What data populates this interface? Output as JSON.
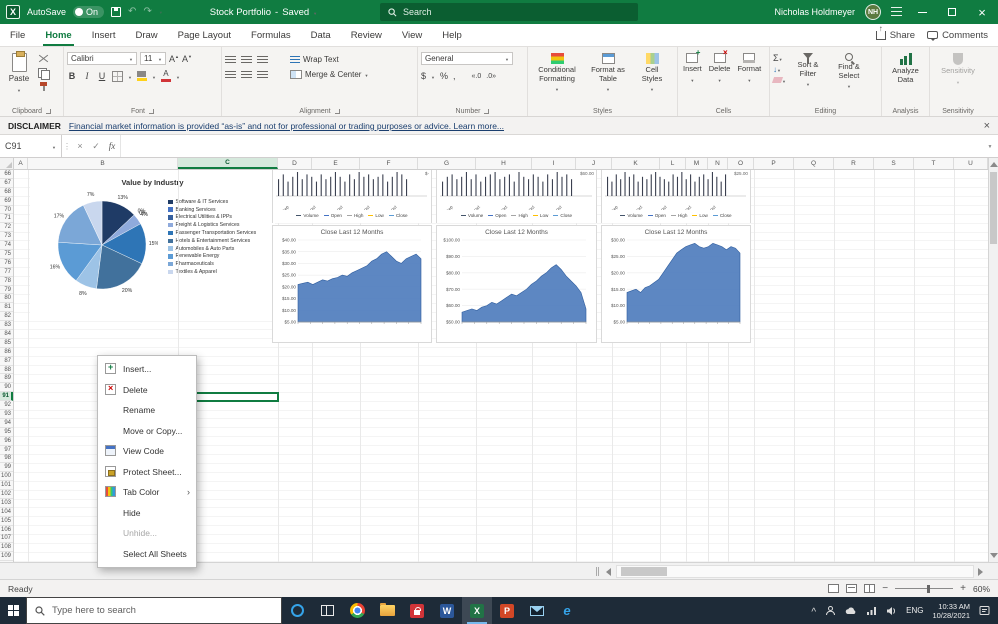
{
  "title_bar": {
    "app": "X",
    "autosave_label": "AutoSave",
    "autosave_state": "On",
    "doc_title": "Stock Portfolio",
    "separator": "-",
    "doc_status": "Saved",
    "search_placeholder": "Search",
    "user_name": "Nicholas Holdmeyer",
    "user_initials": "NH"
  },
  "ribbon": {
    "tabs": [
      {
        "label": "File",
        "active": false
      },
      {
        "label": "Home",
        "active": true
      },
      {
        "label": "Insert",
        "active": false
      },
      {
        "label": "Draw",
        "active": false
      },
      {
        "label": "Page Layout",
        "active": false
      },
      {
        "label": "Formulas",
        "active": false
      },
      {
        "label": "Data",
        "active": false
      },
      {
        "label": "Review",
        "active": false
      },
      {
        "label": "View",
        "active": false
      },
      {
        "label": "Help",
        "active": false
      }
    ],
    "share": "Share",
    "comments": "Comments",
    "clipboard": {
      "label": "Clipboard",
      "paste": "Paste"
    },
    "font": {
      "label": "Font",
      "name": "Calibri",
      "size": "11",
      "bold": "B",
      "italic": "I",
      "underline": "U"
    },
    "alignment": {
      "label": "Alignment",
      "wrap": "Wrap Text",
      "merge": "Merge & Center"
    },
    "number": {
      "label": "Number",
      "format": "General",
      "currency": "$",
      "percent": "%",
      "comma": ",",
      "inc_decimal": "«.0",
      "dec_decimal": ".0»"
    },
    "styles": {
      "label": "Styles",
      "conditional": "Conditional Formatting",
      "table": "Format as Table",
      "cell": "Cell Styles"
    },
    "cells": {
      "label": "Cells",
      "insert": "Insert",
      "delete": "Delete",
      "format": "Format"
    },
    "editing": {
      "label": "Editing",
      "sort": "Sort & Filter",
      "find": "Find & Select"
    },
    "analysis": {
      "label": "Analysis",
      "analyze": "Analyze Data"
    },
    "sensitivity": {
      "label": "Sensitivity",
      "button": "Sensitivity"
    }
  },
  "disclaimer": {
    "label": "DISCLAIMER",
    "text": "Financial market information is provided “as-is” and not for professional or trading purposes or advice. Learn more..."
  },
  "formula_bar": {
    "name_box": "C91",
    "fx": "fx",
    "formula": ""
  },
  "grid": {
    "columns": [
      "A",
      "B",
      "C",
      "D",
      "E",
      "F",
      "G",
      "H",
      "I",
      "J",
      "K",
      "L",
      "M",
      "N",
      "O",
      "P",
      "Q",
      "R",
      "S",
      "T",
      "U"
    ],
    "row_start": 66,
    "row_end": 109,
    "selected_column": "C",
    "selected_row": 91,
    "active_cell": "C91"
  },
  "context_menu": {
    "items": [
      {
        "label": "Insert...",
        "icon": "insert-sheet",
        "enabled": true,
        "submenu": false
      },
      {
        "label": "Delete",
        "icon": "delete-sheet",
        "enabled": true,
        "submenu": false
      },
      {
        "label": "Rename",
        "icon": "",
        "enabled": true,
        "submenu": false
      },
      {
        "label": "Move or Copy...",
        "icon": "",
        "enabled": true,
        "submenu": false
      },
      {
        "label": "View Code",
        "icon": "view-code",
        "enabled": true,
        "submenu": false
      },
      {
        "label": "Protect Sheet...",
        "icon": "protect-sheet",
        "enabled": true,
        "submenu": false
      },
      {
        "label": "Tab Color",
        "icon": "tab-color",
        "enabled": true,
        "submenu": true
      },
      {
        "label": "Hide",
        "icon": "",
        "enabled": true,
        "submenu": false
      },
      {
        "label": "Unhide...",
        "icon": "",
        "enabled": false,
        "submenu": false
      },
      {
        "label": "Select All Sheets",
        "icon": "",
        "enabled": true,
        "submenu": false
      }
    ]
  },
  "status_bar": {
    "status": "Ready",
    "zoom": "60%"
  },
  "taskbar": {
    "search_placeholder": "Type here to search",
    "language": "ENG",
    "time": "10:33 AM",
    "date": "10/28/2021"
  },
  "chart_data": [
    {
      "type": "pie",
      "title": "Value by Industry",
      "labels": [
        "Software & IT Services",
        "Banking Services",
        "Electrical Utilities & IPPs",
        "Freight & Logistics Services",
        "Passenger Transportation Services",
        "Hotels & Entertainment Services",
        "Automobiles & Auto Parts",
        "Renewable Energy",
        "Pharmaceuticals",
        "Textiles & Apparel"
      ],
      "values": [
        13,
        0,
        0,
        4,
        15,
        20,
        8,
        16,
        17,
        7
      ],
      "colors": [
        "#1f3b66",
        "#4472c4",
        "#355f9e",
        "#8faadc",
        "#2e75b6",
        "#41719c",
        "#9dc3e6",
        "#5b9bd5",
        "#7ba7d7",
        "#c9d7ee"
      ],
      "legend_position": "right"
    },
    {
      "type": "area",
      "title": "Close Last 12 Months",
      "ylabels": [
        "$40.00",
        "$35.00",
        "$30.00",
        "$25.00",
        "$20.00",
        "$15.00",
        "$10.00",
        "$5.00"
      ],
      "ymin": 5,
      "ymax": 40,
      "values": [
        21,
        21.5,
        22,
        21,
        22,
        23,
        22.5,
        23.5,
        24,
        25,
        24.5,
        26,
        27,
        28,
        29,
        31,
        32,
        34,
        35,
        33,
        31,
        30,
        32,
        33,
        34,
        32
      ],
      "area_color": "#4f7dbd",
      "ohlc_strip": {
        "dates": [
          "28-Sep",
          "5-Oct",
          "12-Oct",
          "19-Oct",
          "26-Oct"
        ],
        "right_label": "$-",
        "legend": [
          "Volume",
          "Open",
          "High",
          "Low",
          "Close"
        ],
        "legend_colors": [
          "#44546a",
          "#4472c4",
          "#a5a5a5",
          "#ffc000",
          "#5b9bd5"
        ],
        "bars": [
          0.7,
          0.9,
          0.6,
          0.8,
          1,
          0.7,
          0.9,
          0.8,
          0.6,
          0.9,
          0.7,
          0.8,
          1,
          0.8,
          0.6,
          0.9,
          0.7,
          1,
          0.8,
          0.9,
          0.7,
          0.8,
          0.9,
          0.6,
          0.8,
          1,
          0.9,
          0.7
        ]
      }
    },
    {
      "type": "area",
      "title": "Close Last 12 Months",
      "ylabels": [
        "$100.00",
        "$90.00",
        "$80.00",
        "$70.00",
        "$60.00",
        "$50.00"
      ],
      "ymin": 50,
      "ymax": 100,
      "values": [
        56,
        57,
        58,
        57,
        59,
        60,
        62,
        61,
        63,
        65,
        67,
        66,
        68,
        70,
        73,
        75,
        78,
        80,
        83,
        85,
        82,
        78,
        75,
        72,
        68,
        58
      ],
      "area_color": "#4f7dbd",
      "ohlc_strip": {
        "dates": [
          "26-Sep",
          "3-Oct",
          "10-Oct",
          "17-Oct",
          "24-Oct"
        ],
        "right_label": "$60.00",
        "legend": [
          "Volume",
          "Open",
          "High",
          "Low",
          "Close"
        ],
        "legend_colors": [
          "#44546a",
          "#4472c4",
          "#a5a5a5",
          "#ffc000",
          "#5b9bd5"
        ],
        "bars": [
          0.6,
          0.8,
          0.9,
          0.7,
          0.8,
          1,
          0.7,
          0.9,
          0.6,
          0.8,
          0.9,
          1,
          0.7,
          0.8,
          0.9,
          0.6,
          1,
          0.8,
          0.7,
          0.9,
          0.8,
          0.6,
          0.9,
          0.7,
          1,
          0.8,
          0.9,
          0.7
        ]
      }
    },
    {
      "type": "area",
      "title": "Close Last 12 Months",
      "ylabels": [
        "$30.00",
        "$25.00",
        "$20.00",
        "$15.00",
        "$10.00",
        "$5.00"
      ],
      "ymin": 5,
      "ymax": 30,
      "values": [
        14,
        14.5,
        15,
        14,
        15.5,
        16,
        17,
        18,
        20,
        22,
        24,
        26,
        27,
        28,
        28.5,
        29,
        28,
        27.5,
        28,
        29,
        28.5,
        28,
        27,
        28,
        27.5,
        26
      ],
      "area_color": "#4f7dbd",
      "ohlc_strip": {
        "dates": [
          "27-Sep",
          "4-Oct",
          "11-Oct",
          "18-Oct",
          "25-Oct"
        ],
        "right_label": "$25.00",
        "legend": [
          "Volume",
          "Open",
          "High",
          "Low",
          "Close"
        ],
        "legend_colors": [
          "#44546a",
          "#4472c4",
          "#a5a5a5",
          "#ffc000",
          "#5b9bd5"
        ],
        "bars": [
          0.8,
          0.6,
          0.9,
          0.7,
          1,
          0.8,
          0.9,
          0.6,
          0.8,
          0.7,
          0.9,
          1,
          0.8,
          0.7,
          0.6,
          0.9,
          0.8,
          1,
          0.7,
          0.9,
          0.6,
          0.8,
          0.9,
          0.7,
          1,
          0.8,
          0.6,
          0.9
        ]
      }
    }
  ]
}
